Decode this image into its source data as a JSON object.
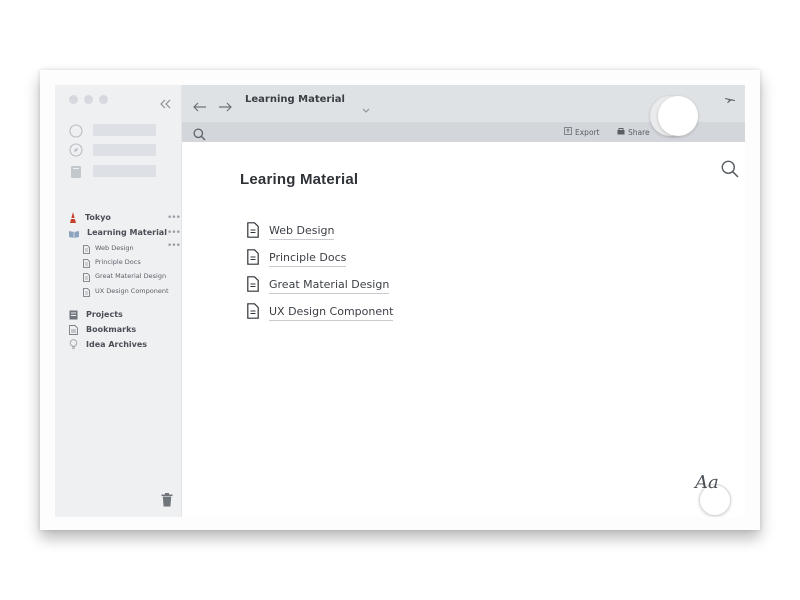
{
  "app": {
    "accent_color": "#c7402c",
    "window_controls": [
      "close",
      "minimize",
      "maximize"
    ]
  },
  "sidebar": {
    "collapse_icon": "double-chevron-left-icon",
    "placeholder_icons": [
      "circle-icon",
      "compass-icon",
      "book-icon"
    ],
    "items": [
      {
        "label": "Tokyo",
        "icon": "tokyo-tower-icon"
      },
      {
        "label": "Learning Material",
        "icon": "open-book-icon",
        "children": [
          "Web Design",
          "Principle Docs",
          "Great Material Design",
          "UX Design Component"
        ]
      },
      {
        "label": "Projects",
        "icon": "projects-icon"
      },
      {
        "label": "Bookmarks",
        "icon": "bookmarks-icon"
      },
      {
        "label": "Idea Archives",
        "icon": "lightbulb-icon"
      }
    ],
    "trash_icon": "trash-icon"
  },
  "topbar": {
    "title": "Learning Material",
    "back_icon": "arrow-left-icon",
    "forward_icon": "arrow-right-icon",
    "dropdown_icon": "chevron-down-icon",
    "airplane_icon": "airplane-icon"
  },
  "toolbar": {
    "export_label": "Export",
    "share_label": "Share"
  },
  "main": {
    "page_title": "Learing Material",
    "documents": [
      "Web Design",
      "Principle Docs",
      "Great Material Design",
      "UX Design Component"
    ],
    "font_button_label": "Aa"
  }
}
